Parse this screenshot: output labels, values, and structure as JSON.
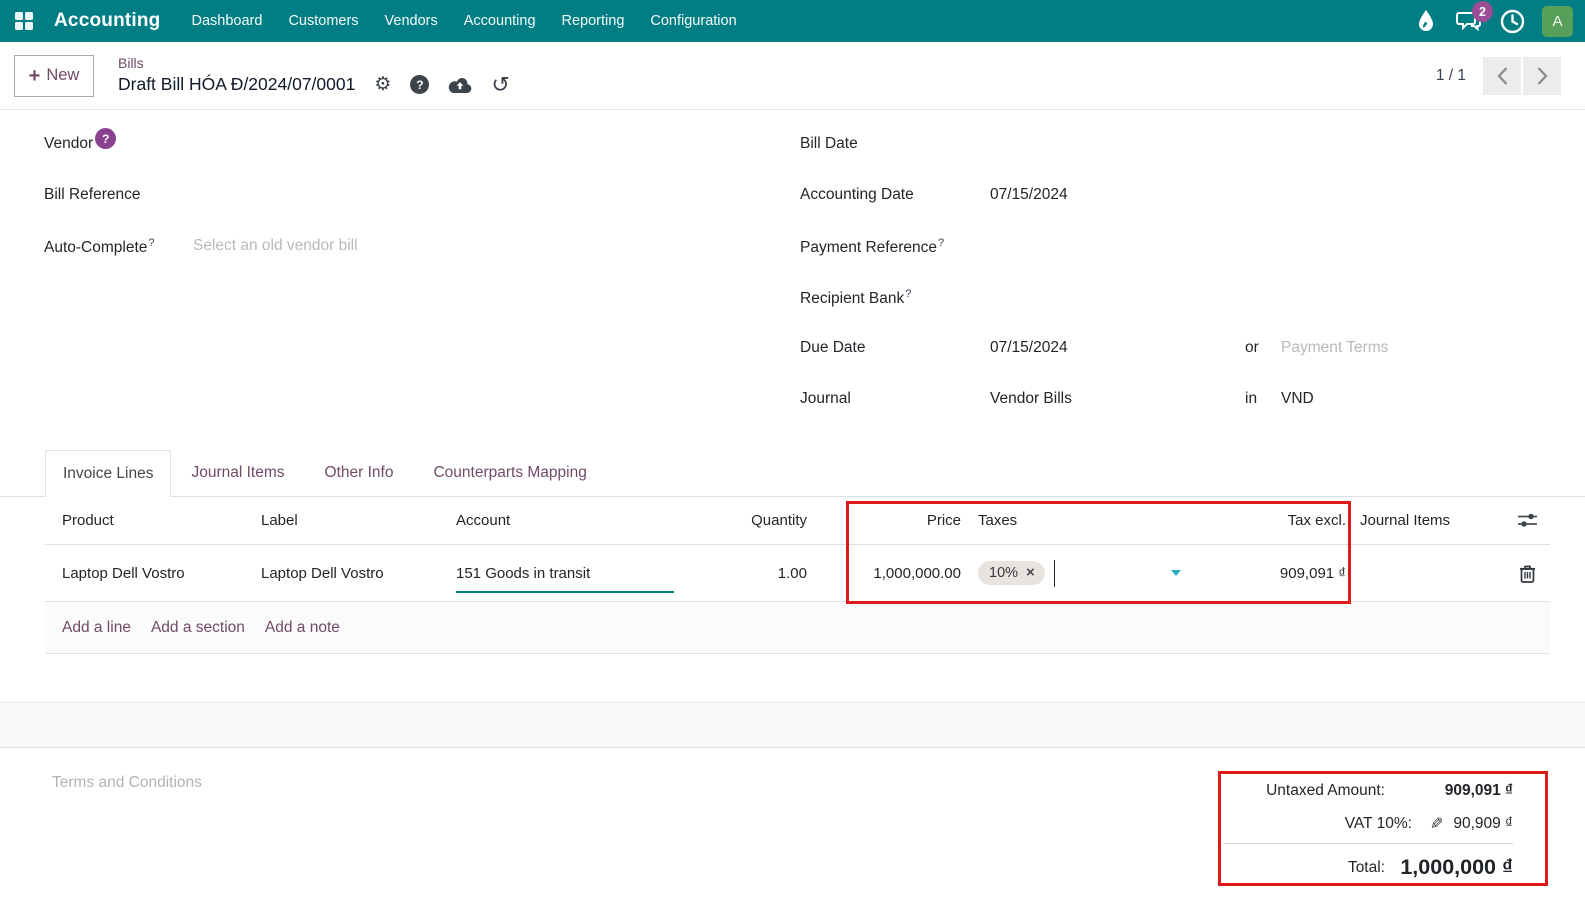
{
  "topbar": {
    "brand": "Accounting",
    "menus": [
      "Dashboard",
      "Customers",
      "Vendors",
      "Accounting",
      "Reporting",
      "Configuration"
    ],
    "message_badge": "2",
    "avatar_initial": "A"
  },
  "control_panel": {
    "new_label": "New",
    "plus_glyph": "+",
    "breadcrumb": "Bills",
    "title": "Draft Bill HÓA Đ/2024/07/0001",
    "pager": "1 / 1"
  },
  "form": {
    "help_marker": "?",
    "left": {
      "vendor_label": "Vendor",
      "bill_reference_label": "Bill Reference",
      "auto_complete_label": "Auto-Complete",
      "auto_complete_placeholder": "Select an old vendor bill"
    },
    "right": {
      "bill_date_label": "Bill Date",
      "accounting_date_label": "Accounting Date",
      "accounting_date_value": "07/15/2024",
      "payment_reference_label": "Payment Reference",
      "recipient_bank_label": "Recipient Bank",
      "due_date_label": "Due Date",
      "due_date_value": "07/15/2024",
      "or_label": "or",
      "payment_terms_placeholder": "Payment Terms",
      "journal_label": "Journal",
      "journal_value": "Vendor Bills",
      "in_label": "in",
      "currency": "VND"
    }
  },
  "tabs": {
    "invoice_lines": "Invoice Lines",
    "journal_items": "Journal Items",
    "other_info": "Other Info",
    "counterparts_mapping": "Counterparts Mapping"
  },
  "lines": {
    "headers": {
      "product": "Product",
      "label": "Label",
      "account": "Account",
      "quantity": "Quantity",
      "price": "Price",
      "taxes": "Taxes",
      "tax_excl": "Tax excl.",
      "journal_items": "Journal Items"
    },
    "row": {
      "product": "Laptop Dell Vostro",
      "label": "Laptop Dell Vostro",
      "account": "151 Goods in transit",
      "quantity": "1.00",
      "price": "1,000,000.00",
      "tax_tag": "10%",
      "tax_remove_glyph": "×",
      "tax_excl": "909,091 ₫"
    },
    "add_line": "Add a line",
    "add_section": "Add a section",
    "add_note": "Add a note"
  },
  "bottom": {
    "terms_placeholder": "Terms and Conditions",
    "totals": {
      "untaxed_label": "Untaxed Amount:",
      "untaxed_value": "909,091 ₫",
      "vat_label": "VAT 10%:",
      "vat_value": "90,909 ₫",
      "total_label": "Total:",
      "total_value": "1,000,000 ₫"
    }
  },
  "icons": {
    "gear": "⚙",
    "undo": "↺",
    "pencil": "✎"
  },
  "colors": {
    "navbar_teal": "#017e84",
    "accent_purple": "#714B67",
    "highlight_red": "#dd1b1b",
    "focus_teal": "#017e84",
    "avatar_green": "#57a05a",
    "badge_purple": "#9b4d95",
    "tax_pill_bg": "#e9e3df"
  }
}
